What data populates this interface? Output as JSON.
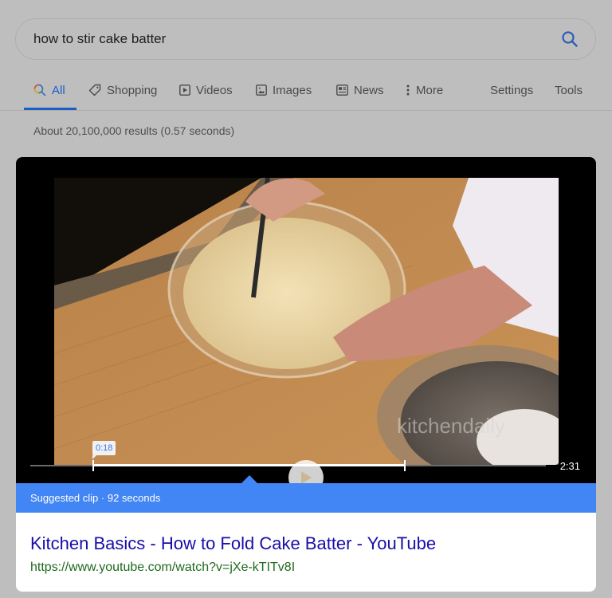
{
  "search": {
    "query": "how to stir cake batter",
    "button_icon": "search-icon"
  },
  "tabs": [
    {
      "label": "All",
      "icon": "search-multicolor-icon",
      "active": true
    },
    {
      "label": "Shopping",
      "icon": "tag-icon"
    },
    {
      "label": "Videos",
      "icon": "play-box-icon"
    },
    {
      "label": "Images",
      "icon": "image-icon"
    },
    {
      "label": "News",
      "icon": "newspaper-icon"
    },
    {
      "label": "More",
      "icon": "more-vert-icon"
    }
  ],
  "tools": {
    "settings_label": "Settings",
    "tools_label": "Tools"
  },
  "result_stats": "About 20,100,000 results (0.57 seconds)",
  "video_result": {
    "clip_start": "0:18",
    "duration": "2:31",
    "watermark": "kitchendaily",
    "suggested_clip_label": "Suggested clip · 92 seconds",
    "title": "Kitchen Basics - How to Fold Cake Batter - YouTube",
    "url": "https://www.youtube.com/watch?v=jXe-kTITv8I"
  },
  "colors": {
    "accent_blue": "#4285f4",
    "link_title": "#1a0dab",
    "url_green": "#1e6b1e",
    "active_tab": "#1a5ec4"
  }
}
